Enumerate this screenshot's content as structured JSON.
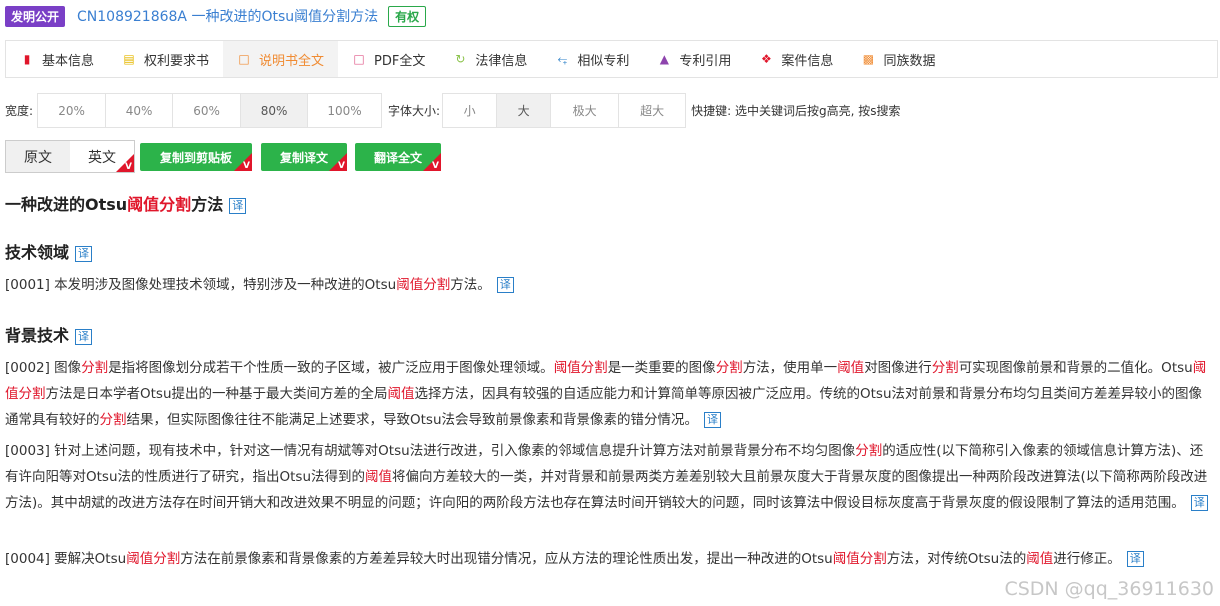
{
  "header": {
    "pub_badge": "发明公开",
    "patent_title": "CN108921868A 一种改进的Otsu阈值分割方法",
    "status_badge": "有权"
  },
  "tabs": [
    {
      "label": "基本信息",
      "icon": "bookmark-icon",
      "active": false
    },
    {
      "label": "权利要求书",
      "icon": "document-icon",
      "active": false
    },
    {
      "label": "说明书全文",
      "icon": "file-icon",
      "active": true
    },
    {
      "label": "PDF全文",
      "icon": "pdf-icon",
      "active": false
    },
    {
      "label": "法律信息",
      "icon": "refresh-icon",
      "active": false
    },
    {
      "label": "相似专利",
      "icon": "share-icon",
      "active": false
    },
    {
      "label": "专利引用",
      "icon": "sitemap-icon",
      "active": false
    },
    {
      "label": "案件信息",
      "icon": "gavel-icon",
      "active": false
    },
    {
      "label": "同族数据",
      "icon": "puzzle-icon",
      "active": false
    }
  ],
  "width_control": {
    "label": "宽度:",
    "options": [
      "20%",
      "40%",
      "60%",
      "80%",
      "100%"
    ],
    "selected": "80%"
  },
  "font_control": {
    "label": "字体大小:",
    "options": [
      "小",
      "大",
      "极大",
      "超大"
    ],
    "selected": "大"
  },
  "shortcut_hint": "快捷键: 选中关键词后按g高亮, 按s搜索",
  "lang_toggle": {
    "original": "原文",
    "english": "英文"
  },
  "buttons": {
    "copy_clipboard": "复制到剪贴板",
    "copy_translation": "复制译文",
    "translate_all": "翻译全文",
    "vip_mark": "V"
  },
  "translate_icon": "译",
  "doc": {
    "title_parts": [
      "一种改进的Otsu",
      "阈值分割",
      "方法"
    ],
    "section1": "技术领域",
    "p0001": [
      "[0001] 本发明涉及图像处理技术领域，特别涉及一种改进的Otsu",
      "阈值分割",
      "方法。"
    ],
    "section2": "背景技术",
    "p0002": [
      "[0002] 图像",
      "分割",
      "是指将图像划分成若干个性质一致的子区域，被广泛应用于图像处理领域。",
      "阈值分割",
      "是一类重要的图像",
      "分割",
      "方法，使用单一",
      "阈值",
      "对图像进行",
      "分割",
      "可实现图像前景和背景的二值化。Otsu",
      "阈值分割",
      "方法是日本学者Otsu提出的一种基于最大类间方差的全局",
      "阈值",
      "选择方法，因具有较强的自适应能力和计算简单等原因被广泛应用。传统的Otsu法对前景和背景分布均匀且类间方差差异较小的图像通常具有较好的",
      "分割",
      "结果，但实际图像往往不能满足上述要求，导致Otsu法会导致前景像素和背景像素的错分情况。"
    ],
    "p0003": [
      "[0003] 针对上述问题，现有技术中，针对这一情况有胡斌等对Otsu法进行改进，引入像素的邻域信息提升计算方法对前景背景分布不均匀图像",
      "分割",
      "的适应性(以下简称引入像素的领域信息计算方法)、还有许向阳等对Otsu法的性质进行了研究，指出Otsu法得到的",
      "阈值",
      "将偏向方差较大的一类，并对背景和前景两类方差差别较大且前景灰度大于背景灰度的图像提出一种两阶段改进算法(以下简称两阶段改进方法)。其中胡斌的改进方法存在时间开销大和改进效果不明显的问题；许向阳的两阶段方法也存在算法时间开销较大的问题，同时该算法中假设目标灰度高于背景灰度的假设限制了算法的适用范围。"
    ],
    "p0004": [
      "[0004] 要解决Otsu",
      "阈值分割",
      "方法在前景像素和背景像素的方差差异较大时出现错分情况，应从方法的理论性质出发，提出一种改进的Otsu",
      "阈值分割",
      "方法，对传统Otsu法的",
      "阈值",
      "进行修正。"
    ]
  },
  "watermark": "CSDN @qq_36911630",
  "colors": {
    "accent": "#f08b32",
    "highlight": "#e0162b",
    "button_green": "#2cb34a",
    "link_blue": "#3a7fd1",
    "pub_purple": "#7a3fc6"
  }
}
